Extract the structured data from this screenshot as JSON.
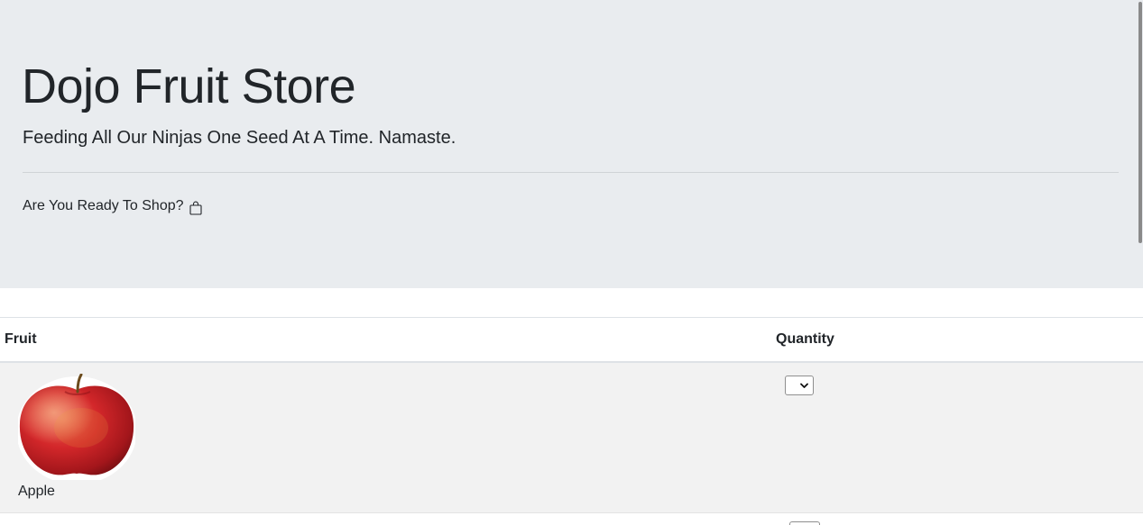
{
  "header": {
    "title": "Dojo Fruit Store",
    "tagline": "Feeding All Our Ninjas One Seed At A Time. Namaste.",
    "shop_prompt": "Are You Ready To Shop?",
    "shop_icon": "shopping-bag-icon"
  },
  "table": {
    "columns": [
      "Fruit",
      "Quantity"
    ],
    "rows": [
      {
        "fruit": "Apple",
        "image": "apple",
        "quantity": ""
      }
    ]
  },
  "colors": {
    "jumbotron_bg": "#e9ecef",
    "row_bg": "#f2f2f2",
    "text": "#212529"
  }
}
